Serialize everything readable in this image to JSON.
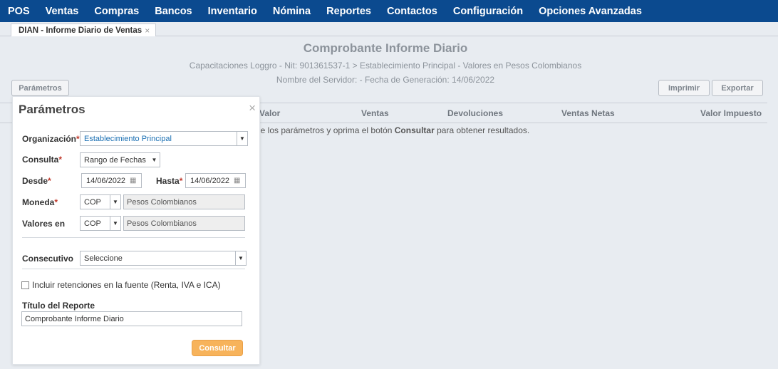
{
  "nav": [
    "POS",
    "Ventas",
    "Compras",
    "Bancos",
    "Inventario",
    "Nómina",
    "Reportes",
    "Contactos",
    "Configuración",
    "Opciones Avanzadas"
  ],
  "tab": {
    "label": "DIAN - Informe Diario de Ventas",
    "close": "×"
  },
  "report": {
    "title": "Comprobante Informe Diario",
    "subtitle": "Capacitaciones Loggro - Nit: 901361537-1 > Establecimiento Principal - Valores en Pesos Colombianos",
    "meta": "Nombre del Servidor: - Fecha de Generación: 14/06/2022"
  },
  "toolbar": {
    "params": "Parámetros",
    "print": "Imprimir",
    "export": "Exportar"
  },
  "columns": [
    "Valor",
    "Ventas",
    "Devoluciones",
    "Ventas Netas",
    "Valor Impuesto"
  ],
  "message": {
    "before": "le los parámetros y oprima el botón ",
    "bold": "Consultar",
    "after": " para obtener resultados."
  },
  "panel": {
    "title": "Parámetros",
    "close": "×",
    "org_label": "Organización",
    "org_value": "Establecimiento Principal",
    "consulta_label": "Consulta",
    "consulta_value": "Rango de Fechas",
    "desde_label": "Desde",
    "desde_value": "14/06/2022",
    "hasta_label": "Hasta",
    "hasta_value": "14/06/2022",
    "moneda_label": "Moneda",
    "moneda_code": "COP",
    "moneda_name": "Pesos Colombianos",
    "valores_label": "Valores en",
    "valores_code": "COP",
    "valores_name": "Pesos Colombianos",
    "consecutivo_label": "Consecutivo",
    "consecutivo_value": "Seleccione",
    "retenciones": "Incluir retenciones en la fuente (Renta, IVA e ICA)",
    "titulo_label": "Título del Reporte",
    "titulo_value": "Comprobante Informe Diario",
    "submit": "Consultar",
    "required_mark": "*"
  }
}
